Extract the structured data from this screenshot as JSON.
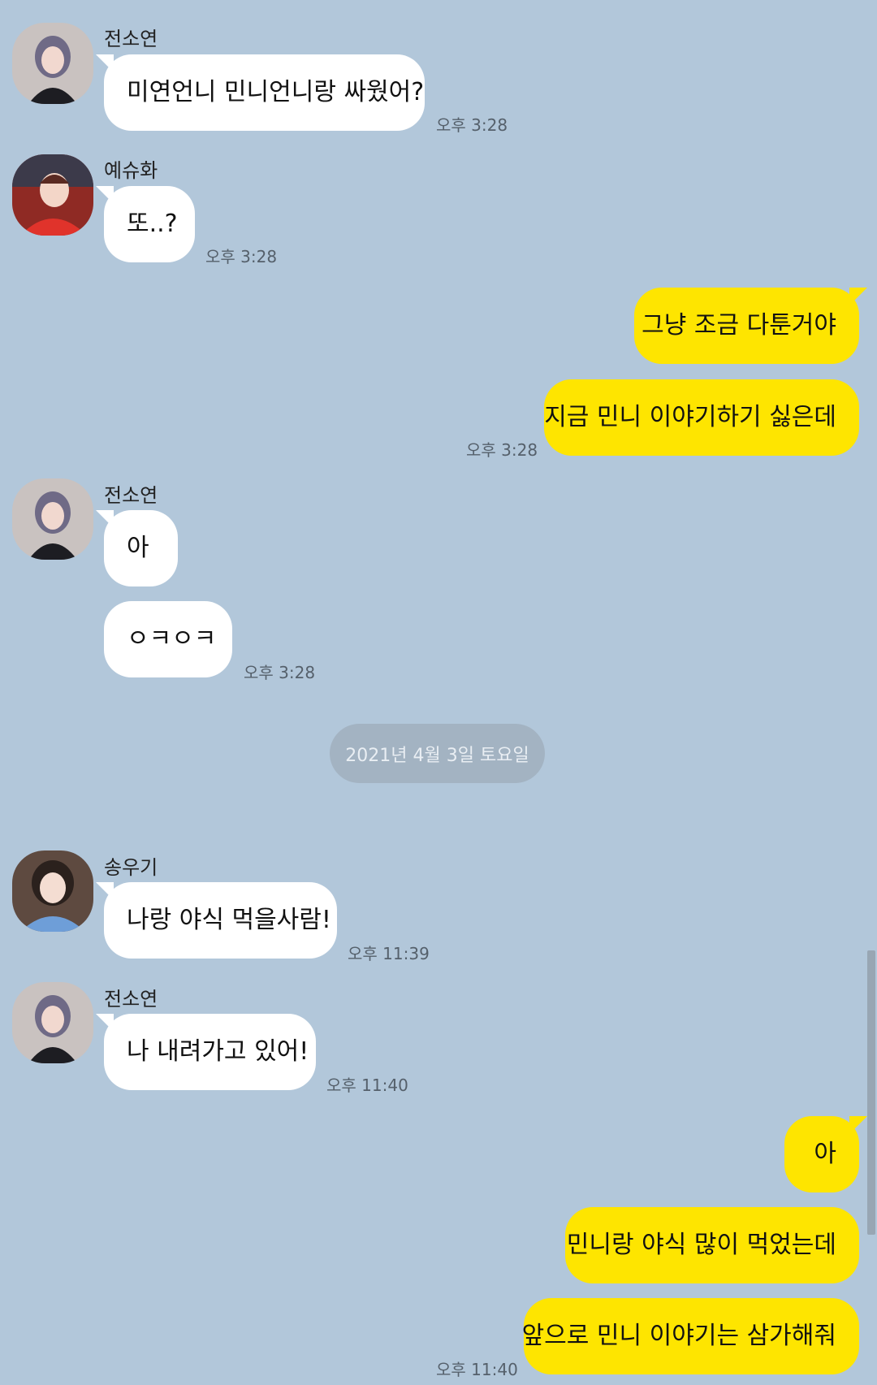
{
  "messages": [
    {
      "sender": "전소연",
      "text": "미연언니 민니언니랑 싸웠어?",
      "time": "오후 3:28"
    },
    {
      "sender": "예슈화",
      "text": "또..?",
      "time": "오후 3:28"
    },
    {
      "self_text": [
        "그냥 조금 다툰거야",
        "지금 민니 이야기하기 싫은데"
      ],
      "time": "오후 3:28"
    },
    {
      "sender": "전소연",
      "text": [
        "아",
        "ㅇㅋㅇㅋ"
      ],
      "time": "오후 3:28"
    },
    {
      "date_divider": "2021년 4월 3일 토요일"
    },
    {
      "sender": "송우기",
      "text": "나랑 야식 먹을사람!",
      "time": "오후 11:39"
    },
    {
      "sender": "전소연",
      "text": "나 내려가고 있어!",
      "time": "오후 11:40"
    },
    {
      "self_text": [
        "아",
        "민니랑 야식 많이 먹었는데",
        "앞으로 민니 이야기는 삼가해줘"
      ],
      "time": "오후 11:40"
    }
  ],
  "colors": {
    "background": "#b2c7da",
    "incoming_bubble": "#ffffff",
    "outgoing_bubble": "#fee500",
    "date_pill": "#a3b3c2"
  }
}
